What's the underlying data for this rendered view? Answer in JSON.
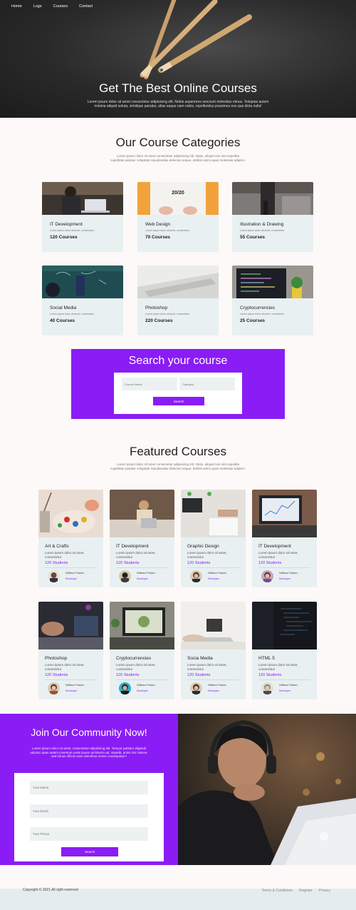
{
  "nav": [
    "Home",
    "Logs",
    "Courses",
    "Contact"
  ],
  "hero": {
    "title": "Get The Best Online Courses",
    "text": "Lorem ipsum dolor sit amet consectetur adipisicing elit. Nobis asperiores nesciunt molestias minus. Voluptas autem minima aliquid soluta, similique pariatur, alias saque nam nobis, repellendus possimus eos qua dicta nulla!"
  },
  "categories": {
    "title": "Our Course Categories",
    "text": "Lorem ipsum dolor sit amet consectetur adipisicing elit. Optio, aliquid non sint expedita cupiditate pariatur voluptate repudiandae delectus neque, debitis animi quae molestias adipisci.",
    "items": [
      {
        "name": "IT Development",
        "desc": "Lorem ipsum dolor sit amet, consectetur",
        "count": "120 Courses"
      },
      {
        "name": "Web Design",
        "desc": "Lorem ipsum dolor sit amet, consectetur",
        "count": "70 Courses"
      },
      {
        "name": "Illustration & Drawing",
        "desc": "Lorem ipsum dolor sit amet, consectetur",
        "count": "55 Courses"
      },
      {
        "name": "Social Media",
        "desc": "Lorem ipsum dolor sit amet, consectetur",
        "count": "40 Courses"
      },
      {
        "name": "Photoshop",
        "desc": "Lorem ipsum dolor sit amet, consectetur",
        "count": "220 Courses"
      },
      {
        "name": "Cryptocurrencies",
        "desc": "Lorem ipsum dolor sit amet, consectetur",
        "count": "25 Courses"
      }
    ]
  },
  "search": {
    "title": "Search your course",
    "course_placeholder": "Course Name",
    "category_placeholder": "Category",
    "button": "Search"
  },
  "featured": {
    "title": "Featured Courses",
    "text": "Lorem ipsum dolor sit amet consectetur adipisicing elit. Optio, aliquid non sint expedita cupiditate pariatur voluptate repudiandae delectus neque, debitis animi quae molestias adipisci.",
    "items": [
      {
        "name": "Art & Crafts",
        "desc": "Lorem ipsum dolor sit amet, consectetur",
        "students": "120 Students",
        "teacher": "William Parker,",
        "role": "Developer"
      },
      {
        "name": "IT Development",
        "desc": "Lorem ipsum dolor sit amet, consectetur",
        "students": "120 Students",
        "teacher": "William Parker,",
        "role": "Developer"
      },
      {
        "name": "Graphic Design",
        "desc": "Lorem ipsum dolor sit amet, consectetur",
        "students": "120 Students",
        "teacher": "William Parker,",
        "role": "Developer"
      },
      {
        "name": "IT Development",
        "desc": "Lorem ipsum dolor sit amet, consectetur",
        "students": "120 Students",
        "teacher": "William Parker,",
        "role": "Developer"
      },
      {
        "name": "Photoshop",
        "desc": "Lorem ipsum dolor sit amet, consectetur",
        "students": "120 Students",
        "teacher": "William Parker,",
        "role": "Developer"
      },
      {
        "name": "Cryptocurrencies",
        "desc": "Lorem ipsum dolor sit amet, consectetur",
        "students": "120 Students",
        "teacher": "William Parker,",
        "role": "Developer"
      },
      {
        "name": "Socia Media",
        "desc": "Lorem ipsum dolor sit amet, consectetur",
        "students": "120 Students",
        "teacher": "William Parker,",
        "role": "Developer"
      },
      {
        "name": "HTML 5",
        "desc": "Lorem ipsum dolor sit amet, consectetur",
        "students": "120 Students",
        "teacher": "William Parker,",
        "role": "Developer"
      }
    ]
  },
  "community": {
    "title": "Join Our Community Now!",
    "text": "Lorem ipsum dolor sit amet, consectetur adipisicing elit. Tempor pariatur eligendi adipisci quas autem inventore unde ipsum architecto ad, impedit, animi nisi ratione, sed minus officiis esse doloribus omnis consequatur?",
    "name_placeholder": "Your Name",
    "email_placeholder": "Your Email",
    "phone_placeholder": "Your Phone",
    "button": "Search"
  },
  "footer": {
    "copyright": "Copyright © 2021 All right reserved",
    "links": [
      "Terms & Conditions",
      "Register",
      "Privacy"
    ]
  },
  "colors": {
    "accent": "#8a1cf5",
    "card_bg": "#e9f0f2",
    "page_bg": "#fcf9f8",
    "footer_bg": "#e5ecef"
  }
}
